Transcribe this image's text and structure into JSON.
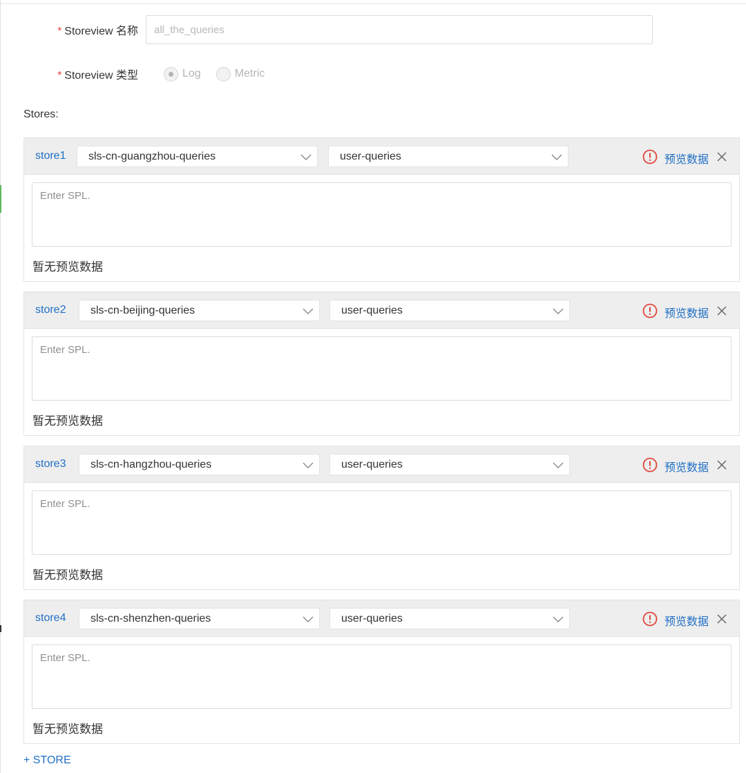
{
  "form": {
    "name_label": "Storeview 名称",
    "name_placeholder": "all_the_queries",
    "type_label": "Storeview 类型",
    "type_options": [
      "Log",
      "Metric"
    ],
    "type_selected": "Log",
    "required_mark": "*"
  },
  "stores_title": "Stores:",
  "stores": [
    {
      "name": "store1",
      "project": "sls-cn-guangzhou-queries",
      "logstore": "user-queries",
      "spl_placeholder": "Enter SPL.",
      "preview_label": "预览数据",
      "no_preview": "暂无预览数据"
    },
    {
      "name": "store2",
      "project": "sls-cn-beijing-queries",
      "logstore": "user-queries",
      "spl_placeholder": "Enter SPL.",
      "preview_label": "预览数据",
      "no_preview": "暂无预览数据"
    },
    {
      "name": "store3",
      "project": "sls-cn-hangzhou-queries",
      "logstore": "user-queries",
      "spl_placeholder": "Enter SPL.",
      "preview_label": "预览数据",
      "no_preview": "暂无预览数据"
    },
    {
      "name": "store4",
      "project": "sls-cn-shenzhen-queries",
      "logstore": "user-queries",
      "spl_placeholder": "Enter SPL.",
      "preview_label": "预览数据",
      "no_preview": "暂无预览数据"
    }
  ],
  "add_store_label": "+ STORE",
  "icons": {
    "warning": "exclamation-circle-icon",
    "close": "close-icon",
    "dropdown": "chevron-down-icon"
  },
  "colors": {
    "link": "#1f6fc5",
    "warning": "#e0453a",
    "required": "#e0453a",
    "header_bg": "#eeeeee"
  }
}
